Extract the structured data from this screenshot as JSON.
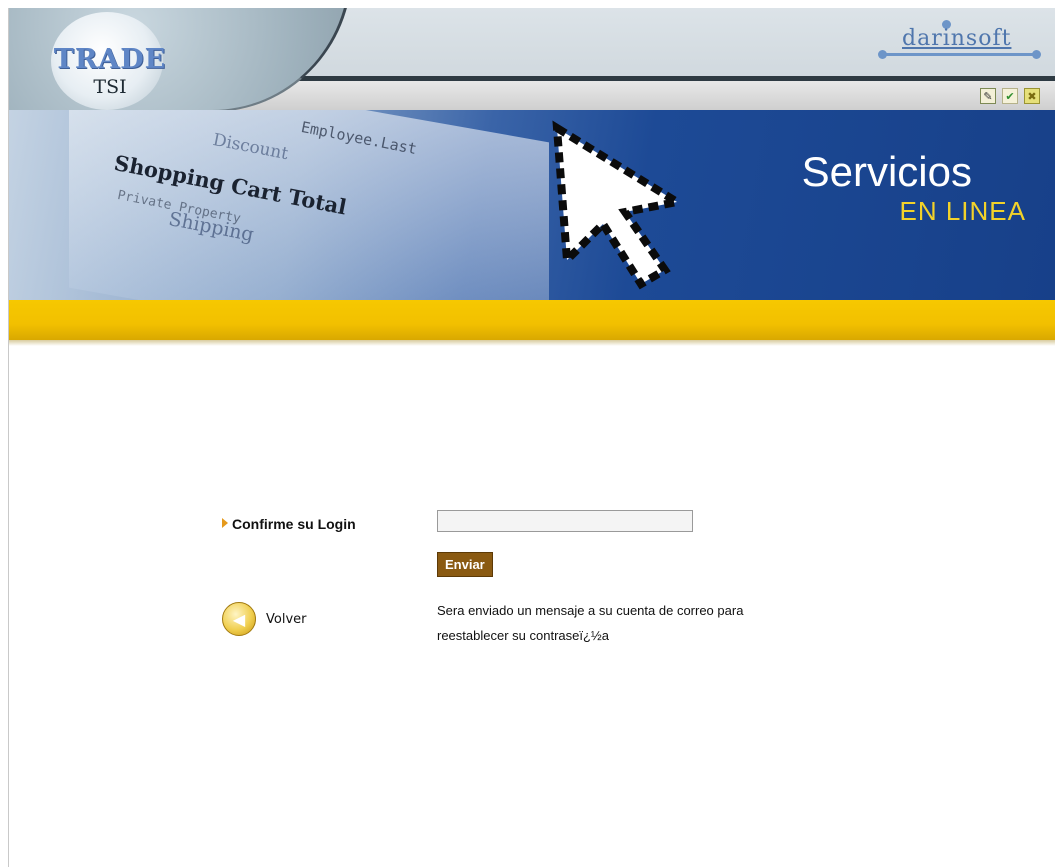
{
  "header": {
    "logo_main": "TRADE",
    "logo_sub": "TSI",
    "brand": "darinsoft",
    "icons": [
      "edit-icon",
      "check-icon",
      "close-icon"
    ]
  },
  "banner": {
    "title": "Servicios",
    "subtitle": "EN LINEA",
    "background_words": [
      "Shopping Cart Total",
      "Discount",
      "Shipping",
      "Employee.Last",
      "Private Property"
    ]
  },
  "form": {
    "login_label": "Confirme su Login",
    "login_value": "",
    "send_label": "Enviar",
    "back_label": "Volver",
    "message_line1": "Sera enviado un mensaje a su cuenta de correo para",
    "message_line2": "reestablecer su contraseï¿½a"
  },
  "colors": {
    "accent_yellow": "#f2c000",
    "button_brown": "#8a5a12",
    "banner_blue": "#1d4a96",
    "subtitle_yellow": "#f2d22a"
  }
}
